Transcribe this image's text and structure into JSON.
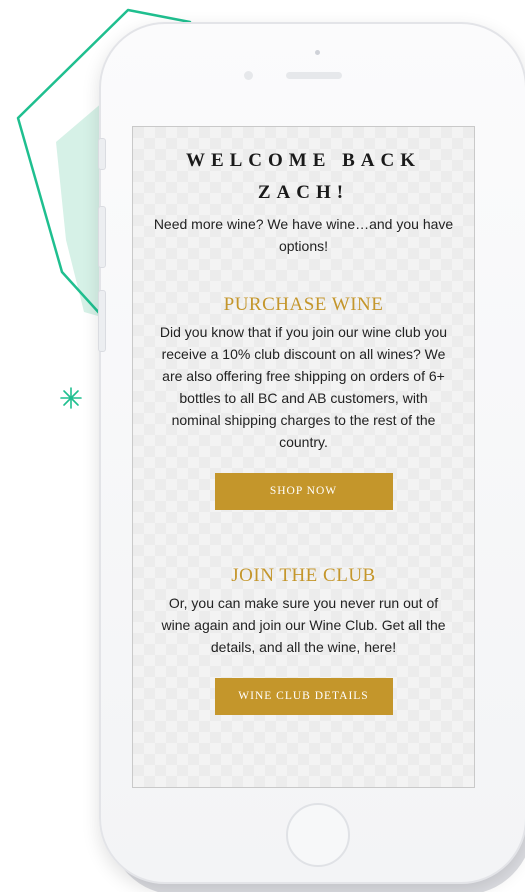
{
  "email": {
    "greeting": "WELCOME BACK ZACH!",
    "intro": "Need more wine? We have wine…and you have options!",
    "purchase": {
      "title": "PURCHASE WINE",
      "body": "Did you know that if you join our wine club you receive a 10% club discount on all wines? We are also offering free shipping on orders of 6+ bottles to all BC and AB customers, with nominal shipping charges to the rest of the country.",
      "button_label": "SHOP NOW"
    },
    "club": {
      "title": "JOIN THE CLUB",
      "body": "Or, you can make sure you never run out of wine again and join our Wine Club. Get all the details, and all the wine, here!",
      "button_label": "WINE CLUB DETAILS"
    }
  },
  "colors": {
    "accent_gold": "#c4962b",
    "deco_teal": "#1fbf8f",
    "deco_mint": "#d6f1e7"
  },
  "icons": {
    "sparkle": "sparkle-icon",
    "hexagon": "hexagon-outline-decoration"
  }
}
